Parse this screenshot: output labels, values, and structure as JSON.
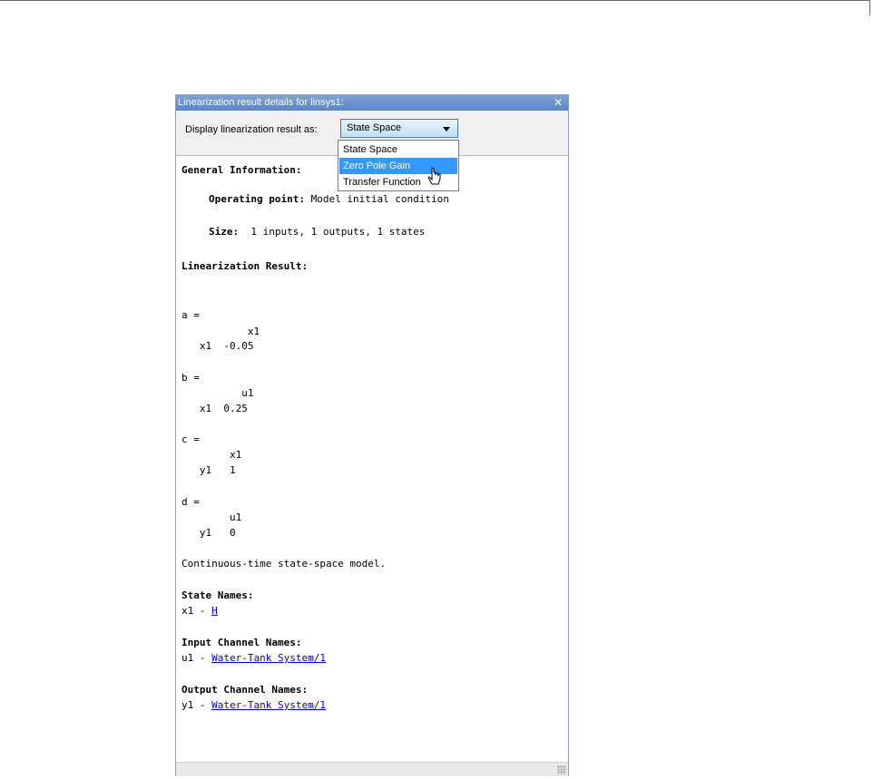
{
  "panel": {
    "title": "Linearization result details for linsys1:",
    "close_glyph": "✕"
  },
  "toolbar": {
    "label": "Display linearization result as:",
    "combo_value": "State Space"
  },
  "dropdown": {
    "options": [
      "State Space",
      "Zero Pole Gain",
      "Transfer Function"
    ],
    "highlighted": "Zero Pole Gain"
  },
  "content": {
    "general_info_heading": "General Information:",
    "operating_point_label": "Operating point:",
    "operating_point_value": " Model initial condition",
    "size_label": "Size:",
    "size_value": "  1 inputs, 1 outputs, 1 states",
    "linearization_heading": "Linearization Result:",
    "matrices": {
      "a_head": "a =",
      "a_col": "           x1",
      "a_row": "   x1  -0.05",
      "b_head": "b =",
      "b_col": "          u1",
      "b_row": "   x1  0.25",
      "c_head": "c =",
      "c_col": "        x1",
      "c_row": "   y1   1",
      "d_head": "d =",
      "d_col": "        u1",
      "d_row": "   y1   0"
    },
    "model_type": "Continuous-time state-space model.",
    "state_names_heading": "State Names:",
    "state_name_prefix": "x1 - ",
    "state_name_link": "H",
    "input_names_heading": "Input Channel Names:",
    "input_name_prefix": "u1 - ",
    "input_name_link": "Water-Tank System/1",
    "output_names_heading": "Output Channel Names:",
    "output_name_prefix": "y1 - ",
    "output_name_link": "Water-Tank System/1"
  }
}
